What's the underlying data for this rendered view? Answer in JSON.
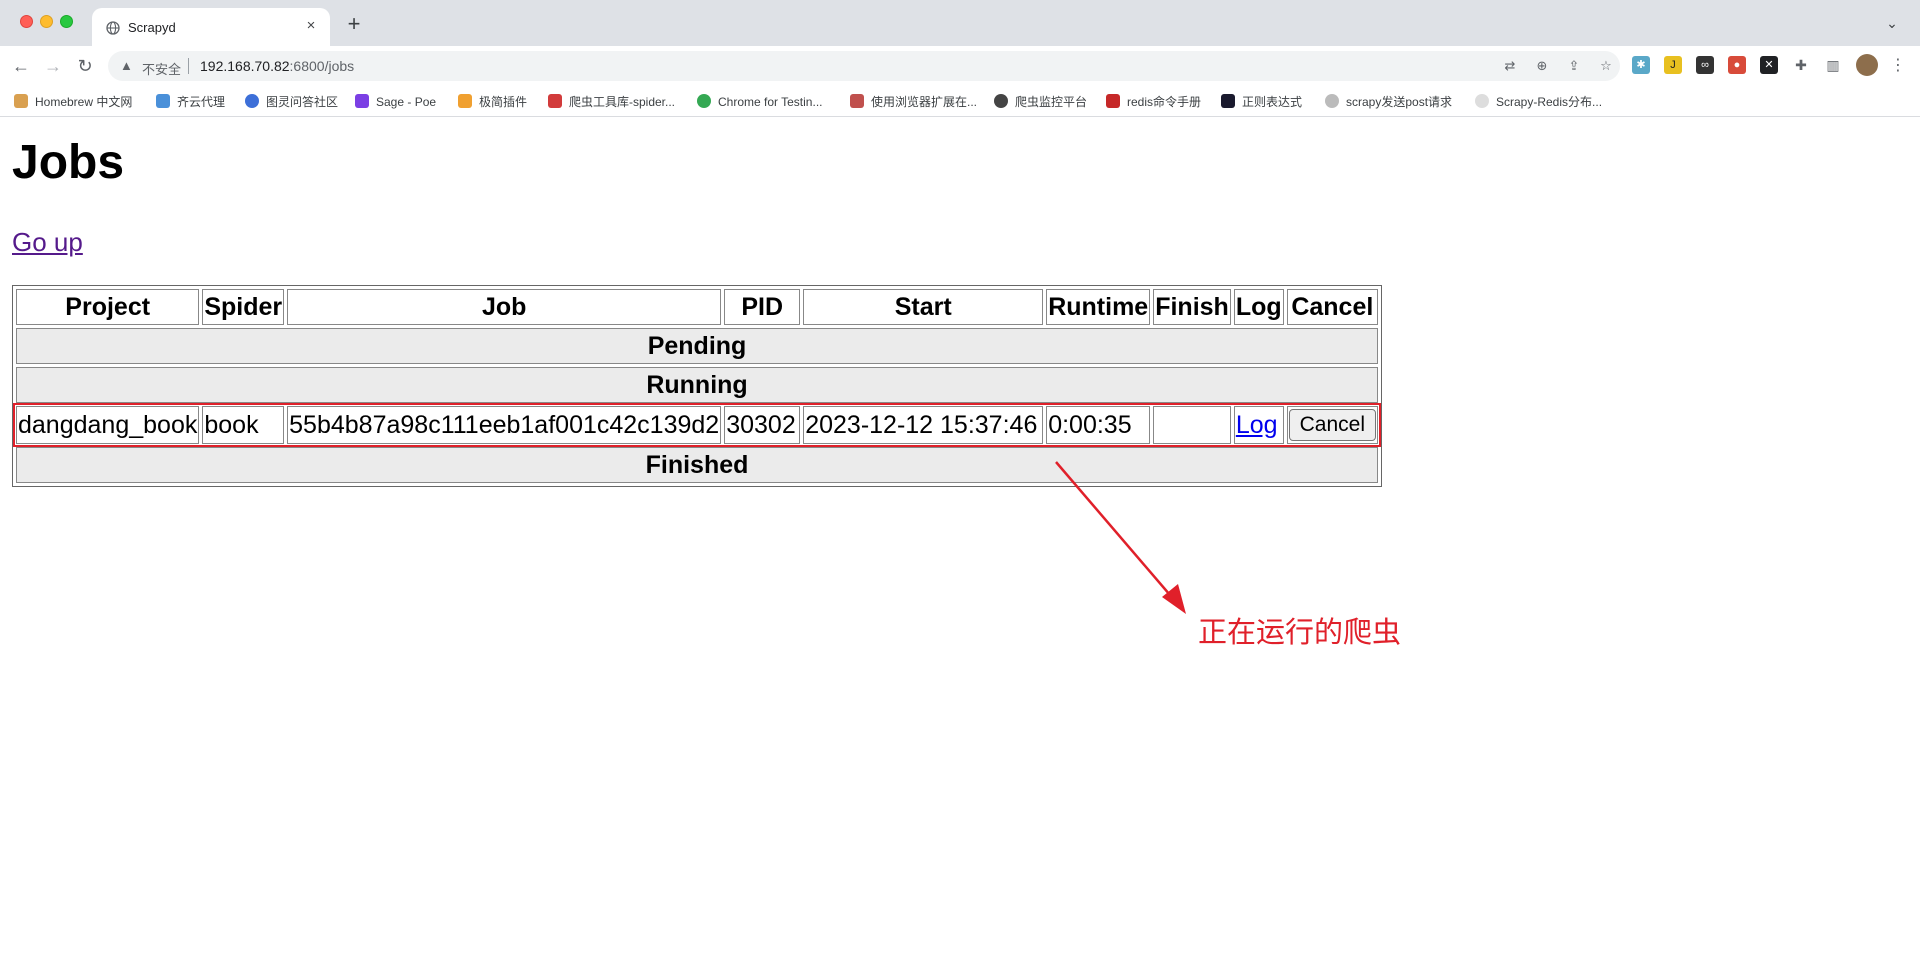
{
  "browser": {
    "tab": {
      "title": "Scrapyd",
      "close_glyph": "×"
    },
    "new_tab_glyph": "+",
    "tab_search_glyph": "⌄",
    "nav": {
      "back": "←",
      "forward": "→",
      "reload": "↻"
    },
    "address": {
      "security_label": "不安全",
      "host": "192.168.70.82",
      "rest": ":6800/jobs"
    },
    "bookmarks": [
      {
        "label": "Homebrew 中文网",
        "color": "#d9a050"
      },
      {
        "label": "齐云代理",
        "color": "#4a90d9"
      },
      {
        "label": "图灵问答社区",
        "color": "#3d6fd8"
      },
      {
        "label": "Sage - Poe",
        "color": "#7b3fe4"
      },
      {
        "label": "极简插件",
        "color": "#f0a030"
      },
      {
        "label": "爬虫工具库-spider...",
        "color": "#d23b3b"
      },
      {
        "label": "Chrome for Testin...",
        "color": "#34a853"
      },
      {
        "label": "使用浏览器扩展在...",
        "color": "#c0504d"
      },
      {
        "label": "爬虫监控平台",
        "color": "#444444"
      },
      {
        "label": "redis命令手册",
        "color": "#c62828"
      },
      {
        "label": "正则表达式",
        "color": "#1a1a2e"
      },
      {
        "label": "scrapy发送post请求",
        "color": "#bbbbbb"
      },
      {
        "label": "Scrapy-Redis分布...",
        "color": "#dddddd"
      }
    ]
  },
  "page": {
    "title": "Jobs",
    "go_up": "Go up",
    "table": {
      "headers": [
        "Project",
        "Spider",
        "Job",
        "PID",
        "Start",
        "Runtime",
        "Finish",
        "Log",
        "Cancel"
      ],
      "sections": {
        "pending": "Pending",
        "running": "Running",
        "finished": "Finished"
      },
      "running_job": {
        "project": "dangdang_book",
        "spider": "book",
        "job": "55b4b87a98c111eeb1af001c42c139d2",
        "pid": "30302",
        "start": "2023-12-12 15:37:46",
        "runtime": "0:00:35",
        "finish": "",
        "log": "Log",
        "cancel": "Cancel"
      }
    },
    "annotation": "正在运行的爬虫",
    "annotation_color": "#e0202a"
  }
}
